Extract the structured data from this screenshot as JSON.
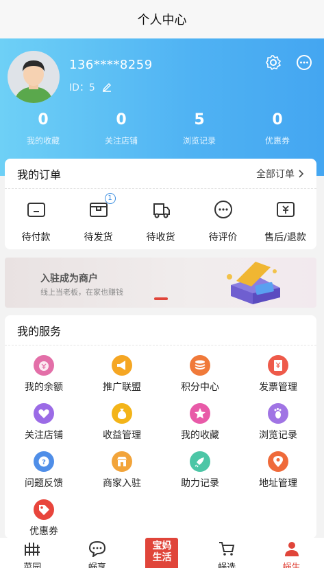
{
  "title": "个人中心",
  "profile": {
    "phone": "136****8259",
    "id_label": "ID：5"
  },
  "stats": [
    {
      "value": "0",
      "label": "我的收藏"
    },
    {
      "value": "0",
      "label": "关注店铺"
    },
    {
      "value": "5",
      "label": "浏览记录"
    },
    {
      "value": "0",
      "label": "优惠券"
    }
  ],
  "orders": {
    "title": "我的订单",
    "all_label": "全部订单",
    "items": [
      {
        "label": "待付款",
        "icon": "wallet-icon"
      },
      {
        "label": "待发货",
        "icon": "package-icon",
        "badge": "1"
      },
      {
        "label": "待收货",
        "icon": "truck-icon"
      },
      {
        "label": "待评价",
        "icon": "comment-icon"
      },
      {
        "label": "售后/退款",
        "icon": "refund-icon"
      }
    ]
  },
  "banner": {
    "title": "入驻成为商户",
    "subtitle": "线上当老板，在家也赚钱"
  },
  "services": {
    "title": "我的服务",
    "items": [
      {
        "label": "我的余额",
        "color": "#e36fa8"
      },
      {
        "label": "推广联盟",
        "color": "#f5a623"
      },
      {
        "label": "积分中心",
        "color": "#f07a3a"
      },
      {
        "label": "发票管理",
        "color": "#ee5a4a"
      },
      {
        "label": "关注店铺",
        "color": "#9b6be6"
      },
      {
        "label": "收益管理",
        "color": "#f3b419"
      },
      {
        "label": "我的收藏",
        "color": "#e85aa8"
      },
      {
        "label": "浏览记录",
        "color": "#a074e4"
      },
      {
        "label": "问题反馈",
        "color": "#4f8ee8"
      },
      {
        "label": "商家入驻",
        "color": "#f2a43a"
      },
      {
        "label": "助力记录",
        "color": "#4cc6a6"
      },
      {
        "label": "地址管理",
        "color": "#ef6a3a"
      },
      {
        "label": "优惠券",
        "color": "#e8453c"
      }
    ]
  },
  "tabbar": {
    "items": [
      {
        "label": "菜园",
        "icon": "garden-icon"
      },
      {
        "label": "蜗享",
        "icon": "chat-icon"
      },
      {
        "label": "宝妈生活",
        "icon": "brand-logo"
      },
      {
        "label": "蜗选",
        "icon": "cart-icon"
      },
      {
        "label": "蜗生",
        "icon": "user-icon"
      }
    ],
    "brand_line1": "宝妈",
    "brand_line2": "生活"
  },
  "colors": {
    "accent": "#e0453a",
    "header_start": "#6ed0f6",
    "header_end": "#44a6f1"
  }
}
